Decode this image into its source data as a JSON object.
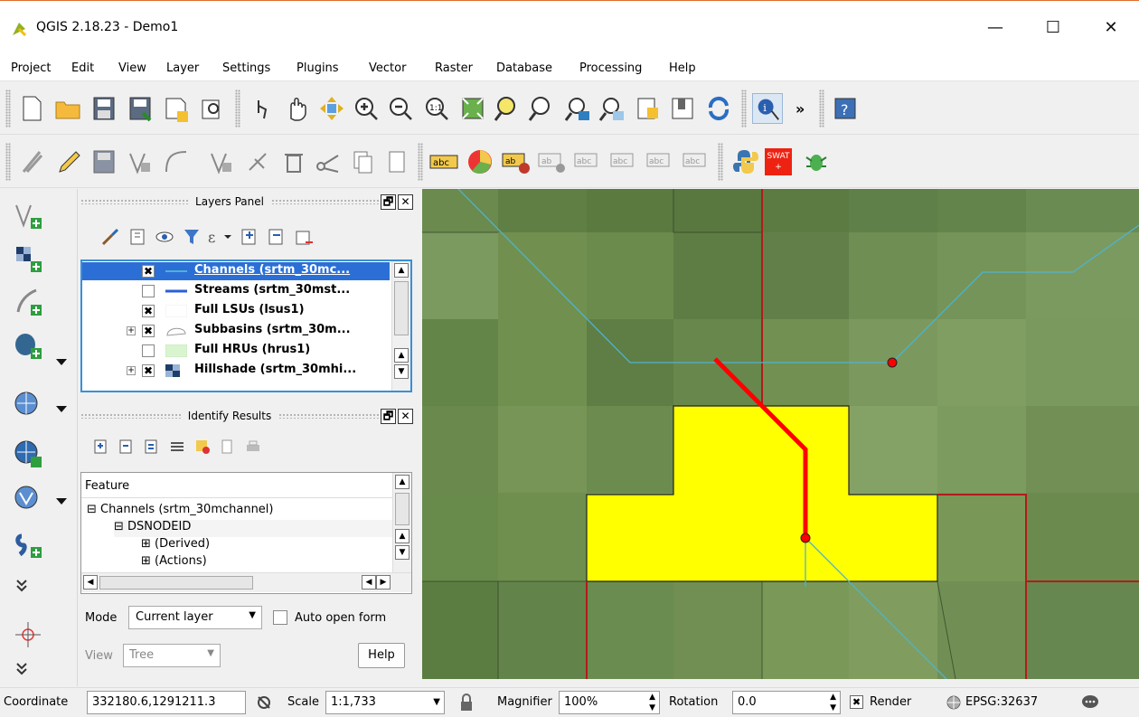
{
  "window": {
    "title": "QGIS 2.18.23 - Demo1",
    "minimize": "—",
    "maximize": "☐",
    "close": "✕"
  },
  "menu": [
    "Project",
    "Edit",
    "View",
    "Layer",
    "Settings",
    "Plugins",
    "Vector",
    "Raster",
    "Database",
    "Processing",
    "Help"
  ],
  "toolbar_top_icons": [
    "new-project-icon",
    "open-project-icon",
    "save-project-icon",
    "save-as-icon",
    "new-print-composer-icon",
    "composer-manager-icon",
    "touch-zoom-icon",
    "pan-icon",
    "pan-to-selection-icon",
    "zoom-in-icon",
    "zoom-out-icon",
    "zoom-native-icon",
    "zoom-full-icon",
    "zoom-to-selection-icon",
    "zoom-to-layer-icon",
    "zoom-last-icon",
    "zoom-next-icon",
    "new-map-view-icon",
    "new-bookmark-icon",
    "refresh-icon",
    "identify-icon",
    "more-icon",
    "help-icon"
  ],
  "toolbar_second_icons": [
    "current-edits-icon",
    "toggle-editing-icon",
    "save-layer-edits-icon",
    "add-feature-icon",
    "move-feature-icon",
    "node-tool-icon",
    "rotate-feature-icon",
    "delete-selected-icon",
    "cut-features-icon",
    "copy-features-icon",
    "paste-features-icon",
    "label-icon",
    "diagram-icon",
    "layer-labeling-icon",
    "pin-labels-icon",
    "show-hide-labels-icon",
    "move-label-icon",
    "rotate-label-icon",
    "change-label-icon",
    "python-console-icon",
    "swat-plus-icon",
    "plugin-bug-icon"
  ],
  "swat_label": "SWAT +",
  "more_label": "»",
  "left_toolbar": [
    "add-vector-layer-icon",
    "add-raster-layer-icon",
    "add-delimited-text-icon",
    "add-postgis-icon",
    "add-wms-icon",
    "add-wfs-icon",
    "add-wcs-icon",
    "add-spatialite-icon",
    "more-layers-icon",
    "gps-tool-icon",
    "more-tools-icon"
  ],
  "layers_panel": {
    "title": "Layers Panel",
    "float_btn": "🗗",
    "close_btn": "✕",
    "layers": [
      {
        "name": "Channels (srtm_30mc...",
        "checked": true,
        "selected": true,
        "expandable": false,
        "symbol": "line-cyan"
      },
      {
        "name": "Streams (srtm_30mst...",
        "checked": false,
        "selected": false,
        "expandable": false,
        "symbol": "line-blue"
      },
      {
        "name": "Full LSUs (lsus1)",
        "checked": true,
        "selected": false,
        "expandable": false,
        "symbol": "fill-white"
      },
      {
        "name": "Subbasins (srtm_30m...",
        "checked": true,
        "selected": false,
        "expandable": true,
        "symbol": "fill-grey"
      },
      {
        "name": "Full HRUs (hrus1)",
        "checked": false,
        "selected": false,
        "expandable": false,
        "symbol": "fill-green"
      },
      {
        "name": "Hillshade (srtm_30mhi...",
        "checked": true,
        "selected": false,
        "expandable": true,
        "symbol": "raster"
      }
    ]
  },
  "identify_panel": {
    "title": "Identify Results",
    "float_btn": "🗗",
    "close_btn": "✕",
    "header": "Feature",
    "tree": [
      {
        "label": "Channels (srtm_30mchannel)",
        "expander": "⊟",
        "level": 0
      },
      {
        "label": "DSNODEID",
        "expander": "⊟",
        "level": 1
      },
      {
        "label": "(Derived)",
        "expander": "⊞",
        "level": 2
      },
      {
        "label": "(Actions)",
        "expander": "⊞",
        "level": 2
      }
    ],
    "mode_label": "Mode",
    "mode_value": "Current layer",
    "auto_open_label": "Auto open form",
    "view_label": "View",
    "view_value": "Tree",
    "help_label": "Help"
  },
  "status_bar": {
    "coordinate_label": "Coordinate",
    "coordinate_value": "332180.6,1291211.3",
    "scale_label": "Scale",
    "scale_value": "1:1,733",
    "magnifier_label": "Magnifier",
    "magnifier_value": "100%",
    "rotation_label": "Rotation",
    "rotation_value": "0.0",
    "render_label": "Render",
    "crs_label": "EPSG:32637"
  },
  "colors": {
    "selected_feature": "#ff0000",
    "highlight_fill": "#ffff00",
    "channel_line": "#4fb3cf",
    "subbasin_border": "#b31b1b",
    "hillshade_dark": "#5e7d45",
    "hillshade_light": "#7d9a5f",
    "selection": "#2b6fd6"
  }
}
